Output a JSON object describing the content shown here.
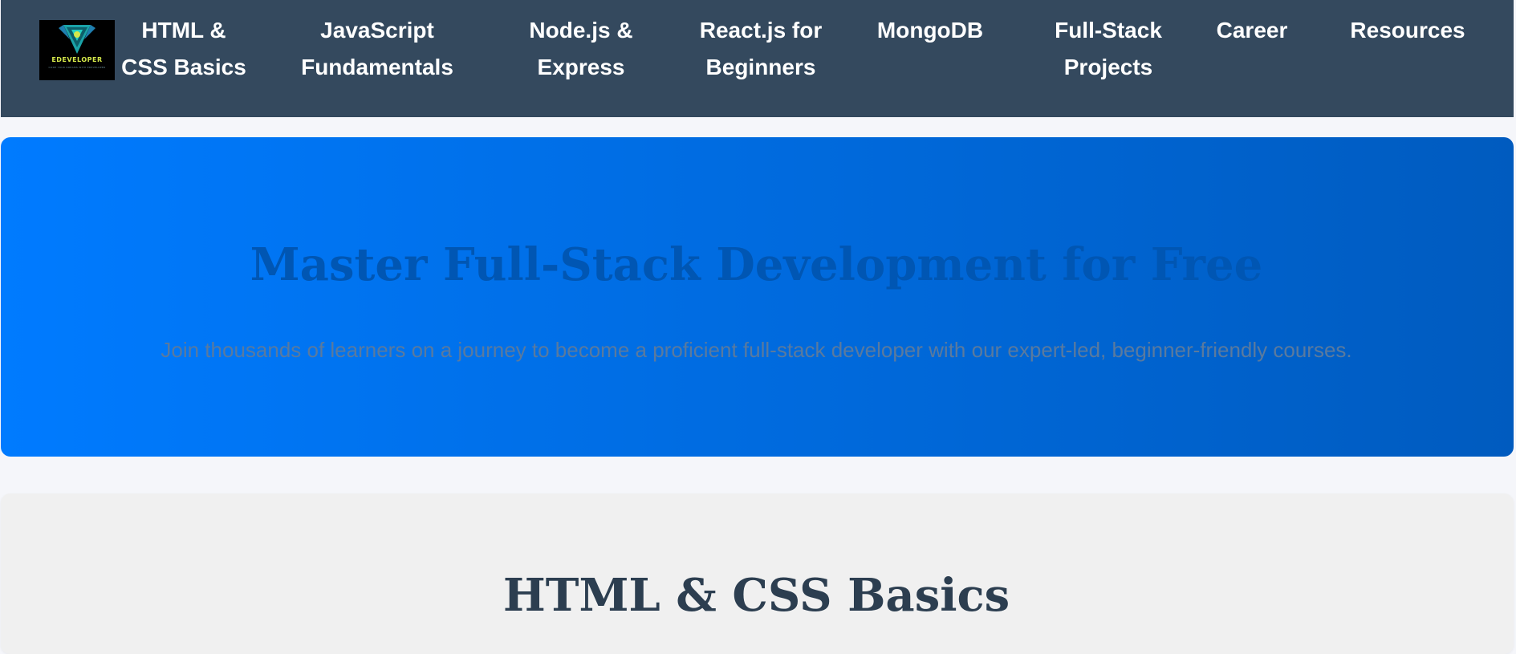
{
  "brand": {
    "name": "EDEVELOPER",
    "tagline": "CODE YOUR DREAMS WITH EDEVELOPER"
  },
  "nav": {
    "items": [
      {
        "line1": "HTML &",
        "line2": "CSS Basics"
      },
      {
        "line1": "JavaScript",
        "line2": "Fundamentals"
      },
      {
        "line1": "Node.js &",
        "line2": "Express"
      },
      {
        "line1": "React.js for",
        "line2": "Beginners"
      },
      {
        "line1": "MongoDB",
        "line2": ""
      },
      {
        "line1": "Full-Stack",
        "line2": "Projects"
      },
      {
        "line1": "Career",
        "line2": ""
      },
      {
        "line1": "Resources",
        "line2": ""
      }
    ]
  },
  "hero": {
    "title": "Master Full-Stack Development for Free",
    "subtitle": "Join thousands of learners on a journey to become a proficient full-stack developer with our expert-led, beginner-friendly courses."
  },
  "section": {
    "title": "HTML & CSS Basics"
  },
  "colors": {
    "navbar": "#34495e",
    "hero_start": "#007bff",
    "hero_end": "#005bbf",
    "hero_title": "#0056b3",
    "section_title": "#2c3e50"
  }
}
